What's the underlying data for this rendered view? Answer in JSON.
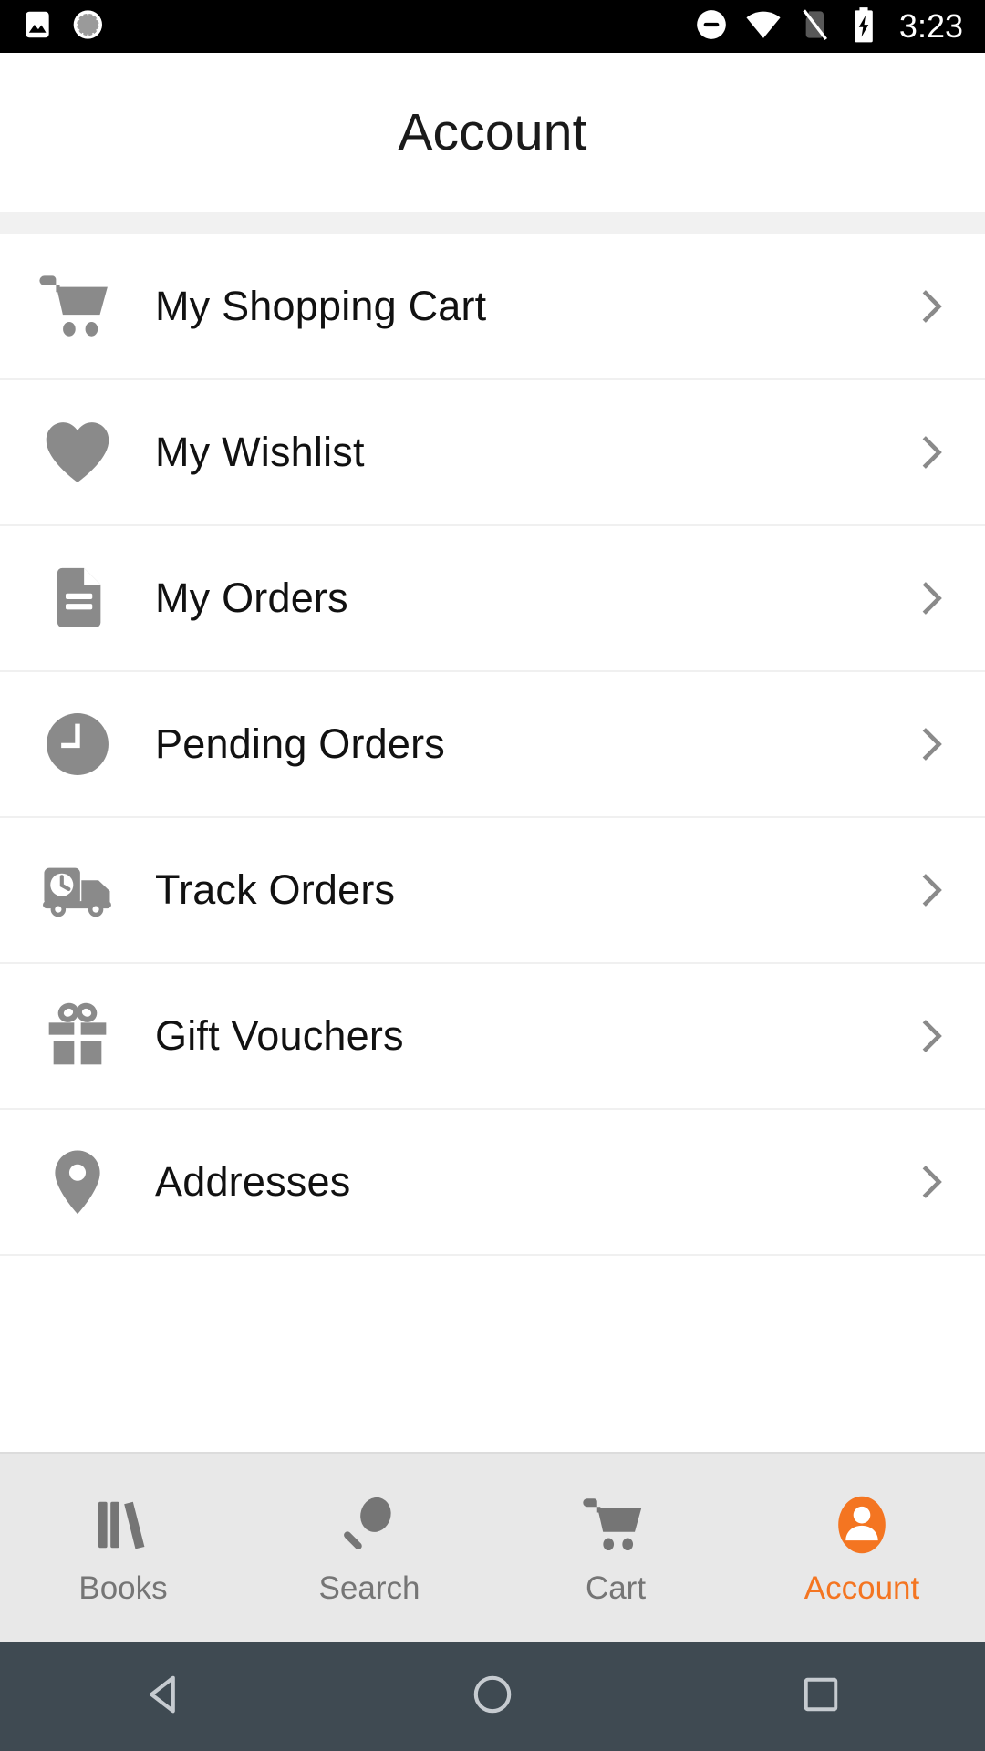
{
  "statusbar": {
    "time": "3:23",
    "left_icons": [
      {
        "name": "photo-image-icon"
      },
      {
        "name": "loading-spinner-icon"
      }
    ],
    "right_icons": [
      {
        "name": "do-not-disturb-icon"
      },
      {
        "name": "wifi-icon"
      },
      {
        "name": "no-sim-card-icon"
      },
      {
        "name": "battery-charging-icon"
      }
    ]
  },
  "header": {
    "title": "Account"
  },
  "menu": {
    "items": [
      {
        "label": "My Shopping Cart",
        "icon": "shopping-cart-icon"
      },
      {
        "label": "My Wishlist",
        "icon": "heart-icon"
      },
      {
        "label": "My Orders",
        "icon": "document-icon"
      },
      {
        "label": "Pending Orders",
        "icon": "clock-icon"
      },
      {
        "label": "Track Orders",
        "icon": "delivery-truck-icon"
      },
      {
        "label": "Gift Vouchers",
        "icon": "gift-icon"
      },
      {
        "label": "Addresses",
        "icon": "location-pin-icon"
      }
    ],
    "chevron_icon": "chevron-right-icon"
  },
  "tabbar": {
    "active_color": "#f47521",
    "inactive_color": "#757575",
    "tabs": [
      {
        "label": "Books",
        "icon": "books-icon",
        "active": false
      },
      {
        "label": "Search",
        "icon": "magnifier-icon",
        "active": false
      },
      {
        "label": "Cart",
        "icon": "shopping-cart-icon",
        "active": false
      },
      {
        "label": "Account",
        "icon": "person-avatar-icon",
        "active": true
      }
    ]
  },
  "navbar": {
    "buttons": [
      {
        "name": "back-button",
        "icon": "triangle-back-icon"
      },
      {
        "name": "home-button",
        "icon": "circle-home-icon"
      },
      {
        "name": "recents-button",
        "icon": "square-recents-icon"
      }
    ]
  }
}
